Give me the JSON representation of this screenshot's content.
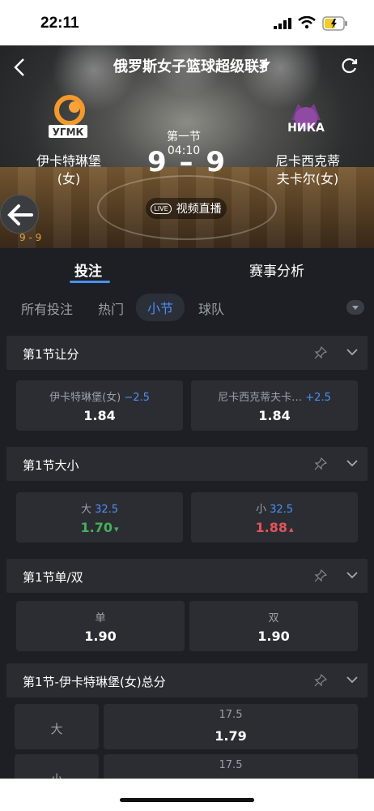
{
  "status": {
    "time": "22:11"
  },
  "header": {
    "league": "俄罗斯女子篮球超级联赛",
    "team_home": "伊卡特琳堡(女)",
    "team_away_line1": "尼卡西克蒂",
    "team_away_line2": "夫卡尔(女)",
    "period": "第一节",
    "clock": "04:10",
    "score_home": "9",
    "score_sep": "–",
    "score_away": "9",
    "live_badge": "LIVE",
    "live_label": "视频直播",
    "home_logo_text": "УГМК",
    "away_logo_text": "НИКА",
    "mini_score": "9 - 9"
  },
  "tabs": [
    {
      "label": "投注"
    },
    {
      "label": "赛事分析"
    }
  ],
  "filters": [
    {
      "label": "所有投注"
    },
    {
      "label": "热门"
    },
    {
      "label": "小节"
    },
    {
      "label": "球队"
    }
  ],
  "sections": [
    {
      "title": "第1节让分",
      "options": [
        {
          "label": "伊卡特琳堡(女)",
          "line": "−2.5",
          "odds": "1.84"
        },
        {
          "label": "尼卡西克蒂夫卡…",
          "line": "+2.5",
          "odds": "1.84"
        }
      ]
    },
    {
      "title": "第1节大小",
      "options": [
        {
          "label": "大",
          "line": "32.5",
          "odds": "1.70",
          "trend": "▾"
        },
        {
          "label": "小",
          "line": "32.5",
          "odds": "1.88",
          "trend": "▴"
        }
      ]
    },
    {
      "title": "第1节单/双",
      "options": [
        {
          "label": "单",
          "odds": "1.90"
        },
        {
          "label": "双",
          "odds": "1.90"
        }
      ]
    },
    {
      "title": "第1节-伊卡特琳堡(女)总分",
      "rows": [
        {
          "side": "大",
          "line": "17.5",
          "odds": "1.79"
        },
        {
          "side": "小",
          "line": "17.5",
          "odds": ""
        }
      ]
    }
  ],
  "colors": {
    "accent": "#4c8ff5",
    "up": "#e0555a",
    "down": "#46b05a",
    "score_yellow": "#e6a53b"
  }
}
